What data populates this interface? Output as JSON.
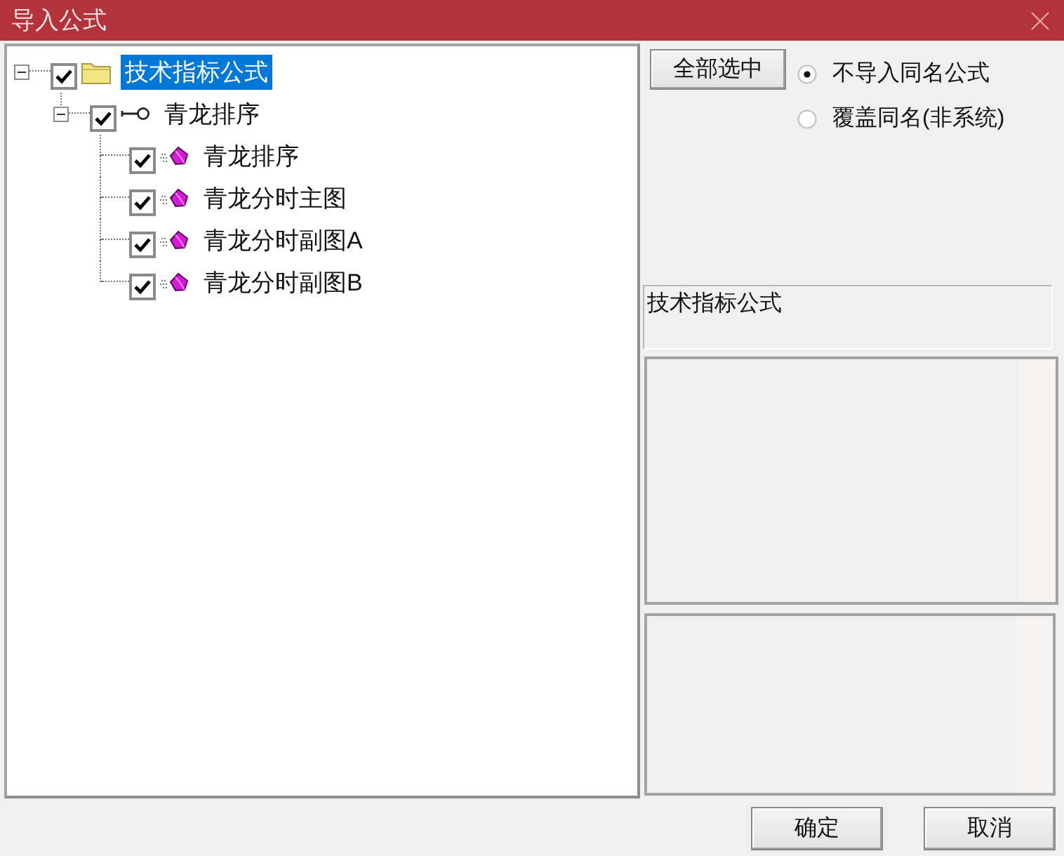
{
  "window": {
    "title": "导入公式"
  },
  "tree": [
    {
      "kind": "folder",
      "label": "技术指标公式",
      "checked": true,
      "expanded": true,
      "selected": true,
      "children": [
        {
          "kind": "key",
          "label": "青龙排序",
          "checked": true,
          "expanded": true,
          "selected": false,
          "children": [
            {
              "kind": "formula",
              "label": "青龙排序",
              "checked": true,
              "selected": false
            },
            {
              "kind": "formula",
              "label": "青龙分时主图",
              "checked": true,
              "selected": false
            },
            {
              "kind": "formula",
              "label": "青龙分时副图A",
              "checked": true,
              "selected": false
            },
            {
              "kind": "formula",
              "label": "青龙分时副图B",
              "checked": true,
              "selected": false
            }
          ]
        }
      ]
    }
  ],
  "select_all_button": {
    "label": "全部选中"
  },
  "options": [
    {
      "label": "不导入同名公式",
      "selected": true
    },
    {
      "label": "覆盖同名(非系统)",
      "selected": false
    }
  ],
  "name_field": {
    "value": "技术指标公式"
  },
  "ok_button": {
    "label": "确定"
  },
  "cancel_button": {
    "label": "取消"
  }
}
